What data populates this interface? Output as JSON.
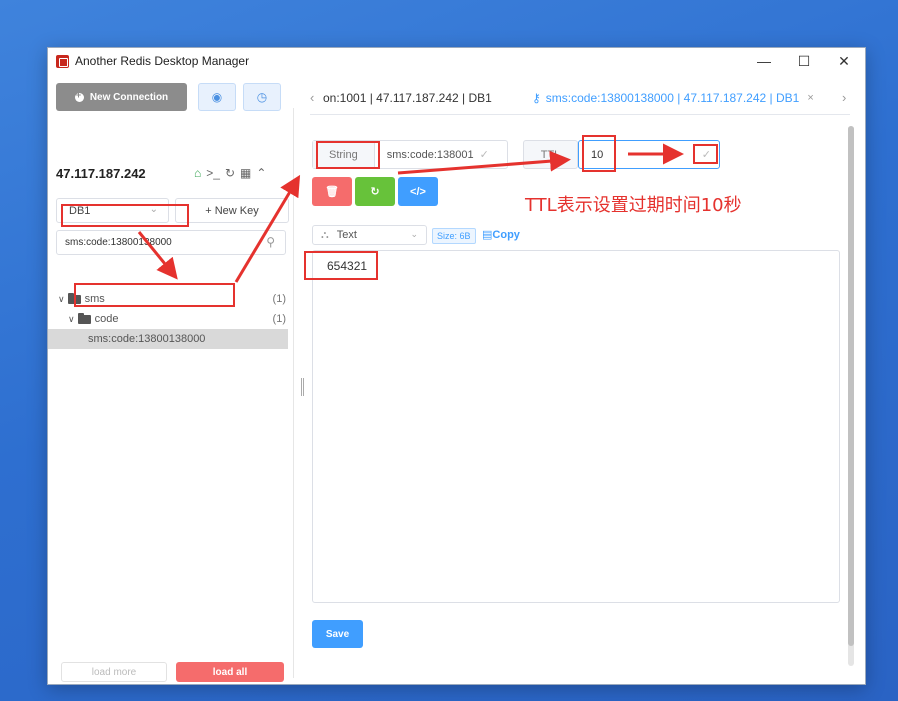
{
  "window": {
    "title": "Another Redis Desktop Manager",
    "minimize": "—",
    "maximize": "☐",
    "close": "✕"
  },
  "sidebar": {
    "new_connection": "New Connection",
    "host": "47.117.187.242",
    "db_select": "DB1",
    "new_key": "+ New Key",
    "search_value": "sms:code:13800138000",
    "tree": [
      {
        "label": "sms",
        "count": "(1)"
      },
      {
        "label": "code",
        "count": "(1)"
      },
      {
        "label": "sms:code:13800138000"
      }
    ],
    "load_more": "load more",
    "load_all": "load all"
  },
  "tabs": [
    {
      "label": "on:1001 | 47.117.187.242 | DB1"
    },
    {
      "label": "sms:code:13800138000 | 47.117.187.242 | DB1",
      "close": "×"
    }
  ],
  "key_bar": {
    "type": "String",
    "key_name": "sms:code:138001",
    "ttl_label": "TTL",
    "ttl_value": "10"
  },
  "annotation": "TTL表示设置过期时间10秒",
  "viewer": {
    "format": "Text",
    "size": "Size: 6B",
    "copy": "Copy",
    "value": "654321",
    "save": "Save"
  },
  "colors": {
    "accent": "#409eff",
    "danger": "#f56c6c",
    "success": "#67c23a",
    "annotation": "#e5322e"
  }
}
